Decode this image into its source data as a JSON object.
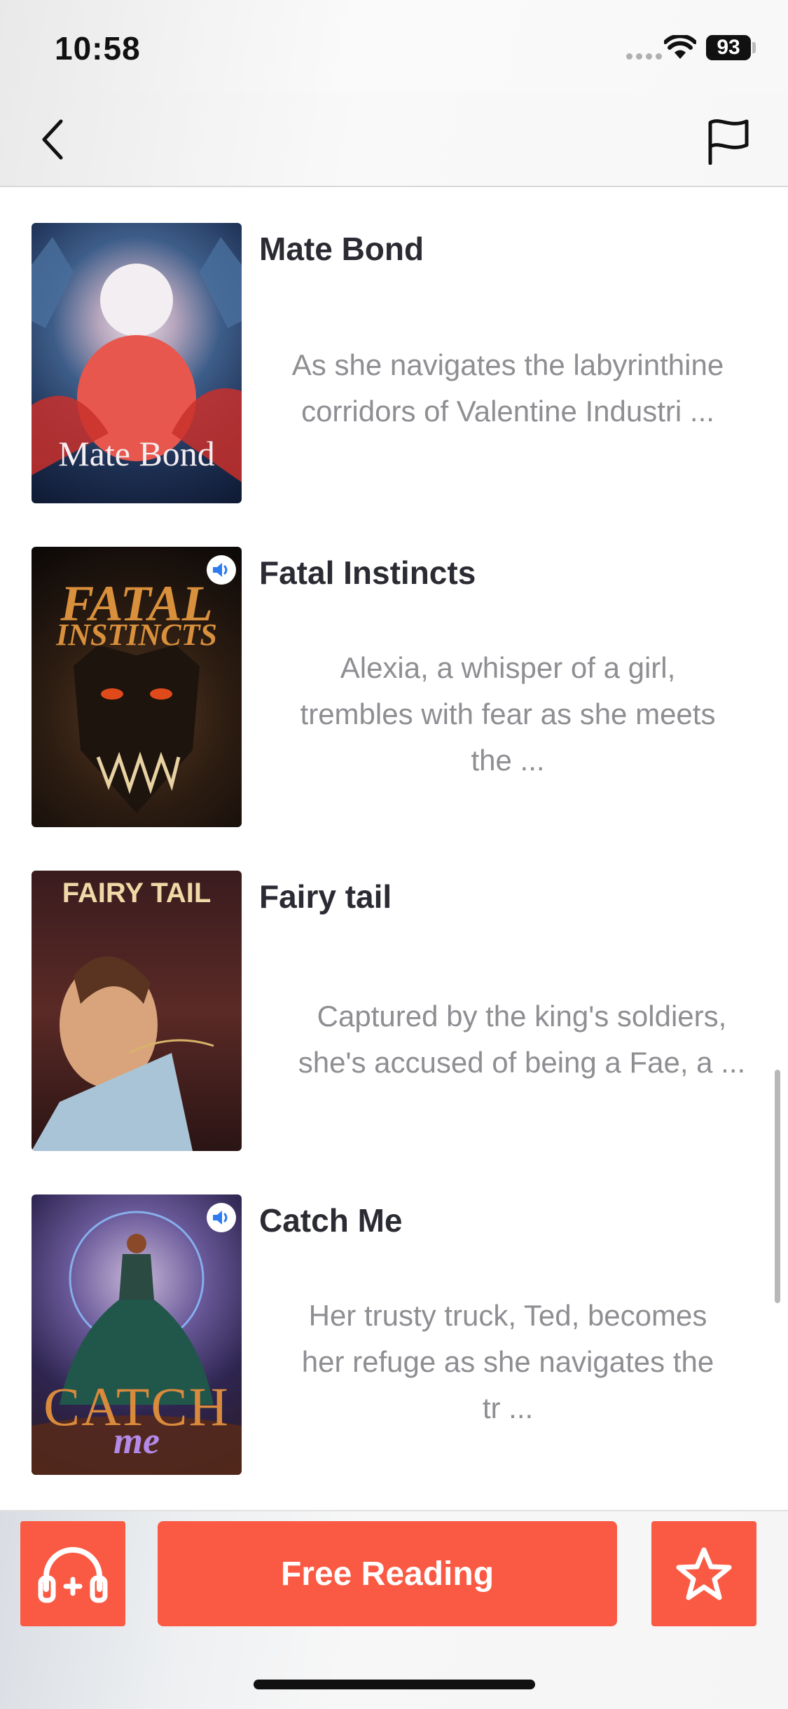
{
  "status": {
    "time": "10:58",
    "battery": "93"
  },
  "nav": {
    "back_icon": "chevron-left-icon",
    "flag_icon": "flag-icon"
  },
  "books": [
    {
      "title": "Mate Bond",
      "desc_lines": [
        "As she navigates the labyrinthine",
        "corridors of Valentine Industri ..."
      ],
      "cover_text": "Mate Bond",
      "has_audio": false
    },
    {
      "title": "Fatal Instincts",
      "desc_lines": [
        "Alexia, a whisper of a girl,",
        "trembles with fear as she meets",
        "the  ..."
      ],
      "cover_text_1": "FATAL",
      "cover_text_2": "INSTINCTS",
      "has_audio": true
    },
    {
      "title": "Fairy tail",
      "desc_lines": [
        "Captured by the king's soldiers,",
        "she's accused of being a Fae, a  ..."
      ],
      "cover_text": "FAIRY TAIL",
      "has_audio": false
    },
    {
      "title": "Catch Me",
      "desc_lines": [
        "Her trusty truck, Ted, becomes",
        "her refuge as she navigates the",
        "tr ..."
      ],
      "cover_text_1": "CATCH",
      "cover_text_2": "me",
      "has_audio": true
    }
  ],
  "bottom": {
    "read_label": "Free Reading",
    "listen_icon": "headphones-icon",
    "star_icon": "star-icon"
  },
  "colors": {
    "accent": "#fa5a43",
    "title": "#2b2b33",
    "desc": "#8e8e93"
  }
}
